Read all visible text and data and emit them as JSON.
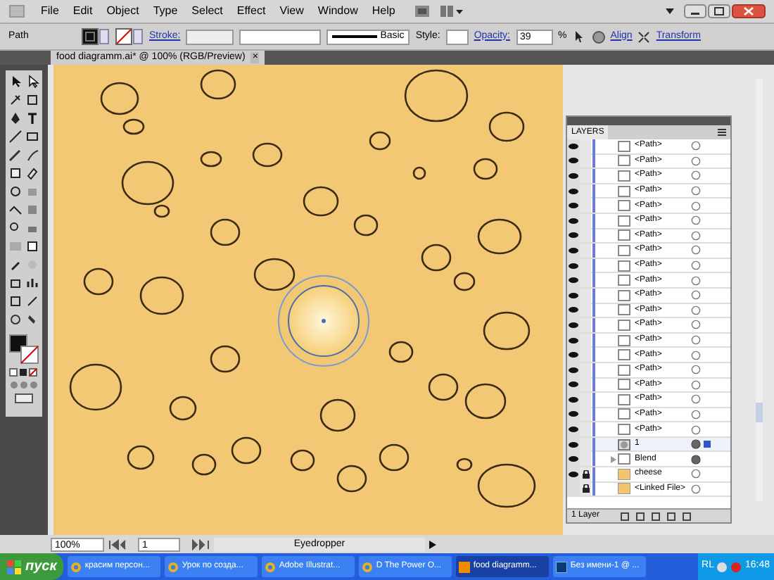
{
  "menu": [
    "File",
    "Edit",
    "Object",
    "Type",
    "Select",
    "Effect",
    "View",
    "Window",
    "Help"
  ],
  "control_bar": {
    "selection": "Path",
    "stroke_label": "Stroke:",
    "brush": "Basic",
    "style_label": "Style:",
    "opacity_label": "Opacity:",
    "opacity": "39",
    "percent": "%",
    "align": "Align",
    "transform": "Transform"
  },
  "document_tab": {
    "title": "food diagramm.ai* @ 100% (RGB/Preview)",
    "close": "×"
  },
  "layers_panel": {
    "title": "LAYERS",
    "rows": [
      {
        "label": "<Path>",
        "kind": "path",
        "visible": true,
        "locked": false,
        "selected": false
      },
      {
        "label": "<Path>",
        "kind": "path",
        "visible": true,
        "locked": false,
        "selected": false
      },
      {
        "label": "<Path>",
        "kind": "path",
        "visible": true,
        "locked": false,
        "selected": false
      },
      {
        "label": "<Path>",
        "kind": "path",
        "visible": true,
        "locked": false,
        "selected": false
      },
      {
        "label": "<Path>",
        "kind": "path",
        "visible": true,
        "locked": false,
        "selected": false
      },
      {
        "label": "<Path>",
        "kind": "path",
        "visible": true,
        "locked": false,
        "selected": false
      },
      {
        "label": "<Path>",
        "kind": "path",
        "visible": true,
        "locked": false,
        "selected": false
      },
      {
        "label": "<Path>",
        "kind": "path",
        "visible": true,
        "locked": false,
        "selected": false
      },
      {
        "label": "<Path>",
        "kind": "path",
        "visible": true,
        "locked": false,
        "selected": false
      },
      {
        "label": "<Path>",
        "kind": "path",
        "visible": true,
        "locked": false,
        "selected": false
      },
      {
        "label": "<Path>",
        "kind": "path",
        "visible": true,
        "locked": false,
        "selected": false
      },
      {
        "label": "<Path>",
        "kind": "path",
        "visible": true,
        "locked": false,
        "selected": false
      },
      {
        "label": "<Path>",
        "kind": "path",
        "visible": true,
        "locked": false,
        "selected": false
      },
      {
        "label": "<Path>",
        "kind": "path",
        "visible": true,
        "locked": false,
        "selected": false
      },
      {
        "label": "<Path>",
        "kind": "path",
        "visible": true,
        "locked": false,
        "selected": false
      },
      {
        "label": "<Path>",
        "kind": "path",
        "visible": true,
        "locked": false,
        "selected": false
      },
      {
        "label": "<Path>",
        "kind": "path",
        "visible": true,
        "locked": false,
        "selected": false
      },
      {
        "label": "<Path>",
        "kind": "path",
        "visible": true,
        "locked": false,
        "selected": false
      },
      {
        "label": "<Path>",
        "kind": "path",
        "visible": true,
        "locked": false,
        "selected": false
      },
      {
        "label": "<Path>",
        "kind": "path",
        "visible": true,
        "locked": false,
        "selected": false
      },
      {
        "label": "1",
        "kind": "blend-step",
        "visible": true,
        "locked": false,
        "selected": true
      },
      {
        "label": "Blend",
        "kind": "blend",
        "visible": true,
        "locked": false,
        "selected": false
      },
      {
        "label": "cheese",
        "kind": "image",
        "visible": true,
        "locked": true,
        "selected": false
      },
      {
        "label": "<Linked File>",
        "kind": "image",
        "visible": false,
        "locked": true,
        "selected": false
      }
    ],
    "footer": "1 Layer"
  },
  "status_bar": {
    "zoom": "100%",
    "artboard": "1",
    "tool": "Eyedropper"
  },
  "taskbar": {
    "start": "пуск",
    "tasks": [
      {
        "label": "красим персон...",
        "kind": "browser",
        "selected": false
      },
      {
        "label": "Урок по созда...",
        "kind": "browser",
        "selected": false
      },
      {
        "label": "Adobe Illustrat...",
        "kind": "browser",
        "selected": false
      },
      {
        "label": "D The Power O...",
        "kind": "browser",
        "selected": false
      },
      {
        "label": "food diagramm...",
        "kind": "illustrator",
        "selected": true
      },
      {
        "label": "Без имени-1 @ ...",
        "kind": "photoshop",
        "selected": false
      }
    ],
    "language": "RL",
    "time": "16:48"
  }
}
